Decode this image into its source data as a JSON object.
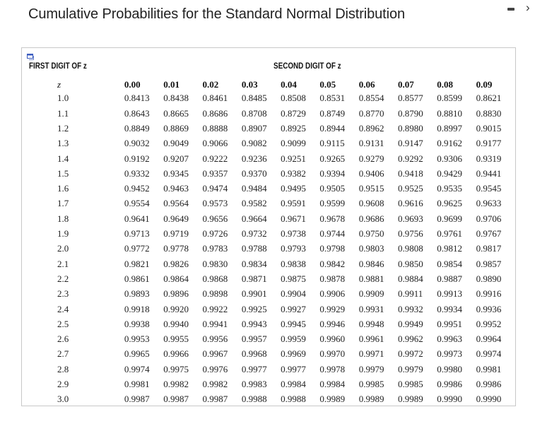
{
  "title": "Cumulative Probabilities for the Standard Normal Distribution",
  "window_controls": {
    "minimize_icon": "minimize-icon",
    "next_icon": "chevron-right-icon",
    "next_glyph": "›"
  },
  "table": {
    "expand_icon": "expand-window-icon",
    "first_digit_label": "FIRST DIGIT OF z",
    "second_digit_label": "SECOND DIGIT OF z",
    "z_header": "z",
    "columns": [
      "0.00",
      "0.01",
      "0.02",
      "0.03",
      "0.04",
      "0.05",
      "0.06",
      "0.07",
      "0.08",
      "0.09"
    ],
    "rows": [
      {
        "z": "1.0",
        "values": [
          "0.8413",
          "0.8438",
          "0.8461",
          "0.8485",
          "0.8508",
          "0.8531",
          "0.8554",
          "0.8577",
          "0.8599",
          "0.8621"
        ]
      },
      {
        "z": "1.1",
        "values": [
          "0.8643",
          "0.8665",
          "0.8686",
          "0.8708",
          "0.8729",
          "0.8749",
          "0.8770",
          "0.8790",
          "0.8810",
          "0.8830"
        ]
      },
      {
        "z": "1.2",
        "values": [
          "0.8849",
          "0.8869",
          "0.8888",
          "0.8907",
          "0.8925",
          "0.8944",
          "0.8962",
          "0.8980",
          "0.8997",
          "0.9015"
        ]
      },
      {
        "z": "1.3",
        "values": [
          "0.9032",
          "0.9049",
          "0.9066",
          "0.9082",
          "0.9099",
          "0.9115",
          "0.9131",
          "0.9147",
          "0.9162",
          "0.9177"
        ]
      },
      {
        "z": "1.4",
        "values": [
          "0.9192",
          "0.9207",
          "0.9222",
          "0.9236",
          "0.9251",
          "0.9265",
          "0.9279",
          "0.9292",
          "0.9306",
          "0.9319"
        ]
      },
      {
        "z": "1.5",
        "values": [
          "0.9332",
          "0.9345",
          "0.9357",
          "0.9370",
          "0.9382",
          "0.9394",
          "0.9406",
          "0.9418",
          "0.9429",
          "0.9441"
        ]
      },
      {
        "z": "1.6",
        "values": [
          "0.9452",
          "0.9463",
          "0.9474",
          "0.9484",
          "0.9495",
          "0.9505",
          "0.9515",
          "0.9525",
          "0.9535",
          "0.9545"
        ]
      },
      {
        "z": "1.7",
        "values": [
          "0.9554",
          "0.9564",
          "0.9573",
          "0.9582",
          "0.9591",
          "0.9599",
          "0.9608",
          "0.9616",
          "0.9625",
          "0.9633"
        ]
      },
      {
        "z": "1.8",
        "values": [
          "0.9641",
          "0.9649",
          "0.9656",
          "0.9664",
          "0.9671",
          "0.9678",
          "0.9686",
          "0.9693",
          "0.9699",
          "0.9706"
        ]
      },
      {
        "z": "1.9",
        "values": [
          "0.9713",
          "0.9719",
          "0.9726",
          "0.9732",
          "0.9738",
          "0.9744",
          "0.9750",
          "0.9756",
          "0.9761",
          "0.9767"
        ]
      },
      {
        "z": "2.0",
        "values": [
          "0.9772",
          "0.9778",
          "0.9783",
          "0.9788",
          "0.9793",
          "0.9798",
          "0.9803",
          "0.9808",
          "0.9812",
          "0.9817"
        ]
      },
      {
        "z": "2.1",
        "values": [
          "0.9821",
          "0.9826",
          "0.9830",
          "0.9834",
          "0.9838",
          "0.9842",
          "0.9846",
          "0.9850",
          "0.9854",
          "0.9857"
        ]
      },
      {
        "z": "2.2",
        "values": [
          "0.9861",
          "0.9864",
          "0.9868",
          "0.9871",
          "0.9875",
          "0.9878",
          "0.9881",
          "0.9884",
          "0.9887",
          "0.9890"
        ]
      },
      {
        "z": "2.3",
        "values": [
          "0.9893",
          "0.9896",
          "0.9898",
          "0.9901",
          "0.9904",
          "0.9906",
          "0.9909",
          "0.9911",
          "0.9913",
          "0.9916"
        ]
      },
      {
        "z": "2.4",
        "values": [
          "0.9918",
          "0.9920",
          "0.9922",
          "0.9925",
          "0.9927",
          "0.9929",
          "0.9931",
          "0.9932",
          "0.9934",
          "0.9936"
        ]
      },
      {
        "z": "2.5",
        "values": [
          "0.9938",
          "0.9940",
          "0.9941",
          "0.9943",
          "0.9945",
          "0.9946",
          "0.9948",
          "0.9949",
          "0.9951",
          "0.9952"
        ]
      },
      {
        "z": "2.6",
        "values": [
          "0.9953",
          "0.9955",
          "0.9956",
          "0.9957",
          "0.9959",
          "0.9960",
          "0.9961",
          "0.9962",
          "0.9963",
          "0.9964"
        ]
      },
      {
        "z": "2.7",
        "values": [
          "0.9965",
          "0.9966",
          "0.9967",
          "0.9968",
          "0.9969",
          "0.9970",
          "0.9971",
          "0.9972",
          "0.9973",
          "0.9974"
        ]
      },
      {
        "z": "2.8",
        "values": [
          "0.9974",
          "0.9975",
          "0.9976",
          "0.9977",
          "0.9977",
          "0.9978",
          "0.9979",
          "0.9979",
          "0.9980",
          "0.9981"
        ]
      },
      {
        "z": "2.9",
        "values": [
          "0.9981",
          "0.9982",
          "0.9982",
          "0.9983",
          "0.9984",
          "0.9984",
          "0.9985",
          "0.9985",
          "0.9986",
          "0.9986"
        ]
      },
      {
        "z": "3.0",
        "values": [
          "0.9987",
          "0.9987",
          "0.9987",
          "0.9988",
          "0.9988",
          "0.9989",
          "0.9989",
          "0.9989",
          "0.9990",
          "0.9990"
        ]
      }
    ]
  },
  "colors": {
    "text": "#222222",
    "border": "#c8c8c8",
    "expand_icon": "#3a5bbf"
  }
}
